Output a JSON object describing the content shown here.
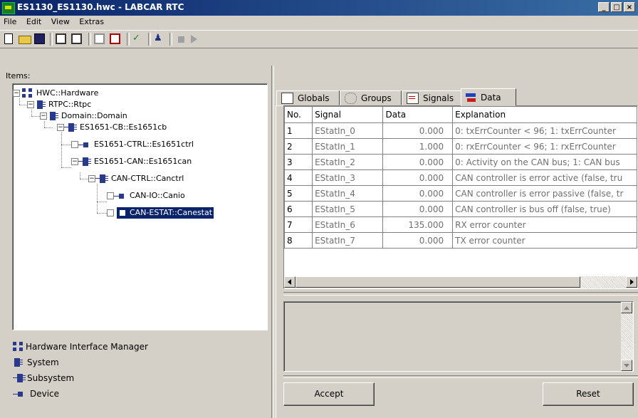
{
  "window": {
    "title": "ES1130_ES1130.hwc - LABCAR RTC",
    "min": "_",
    "max": "□",
    "close": "×"
  },
  "menu": [
    "File",
    "Edit",
    "View",
    "Extras"
  ],
  "items_label": "Items:",
  "tree": [
    {
      "label": "HWC::Hardware"
    },
    {
      "label": "RTPC::Rtpc"
    },
    {
      "label": "Domain::Domain"
    },
    {
      "label": "ES1651-CB::Es1651cb"
    },
    {
      "label": "ES1651-CTRL::Es1651ctrl"
    },
    {
      "label": "ES1651-CAN::Es1651can"
    },
    {
      "label": "CAN-CTRL::Canctrl"
    },
    {
      "label": "CAN-IO::Canio"
    },
    {
      "label": "CAN-ESTAT::Canestat"
    }
  ],
  "legend": [
    {
      "label": "Hardware Interface Manager"
    },
    {
      "label": "System"
    },
    {
      "label": "Subsystem"
    },
    {
      "label": "Device"
    }
  ],
  "tabs": [
    {
      "label": "Globals"
    },
    {
      "label": "Groups"
    },
    {
      "label": "Signals"
    },
    {
      "label": "Data"
    }
  ],
  "table": {
    "headers": [
      "No.",
      "Signal",
      "Data",
      "Explanation"
    ],
    "rows": [
      [
        "1",
        "EStatIn_0",
        "0.000",
        "0: txErrCounter < 96; 1: txErrCounter"
      ],
      [
        "2",
        "EStatIn_1",
        "1.000",
        "0: rxErrCounter < 96; 1: rxErrCounter"
      ],
      [
        "3",
        "EStatIn_2",
        "0.000",
        "0: Activity on the CAN bus; 1: CAN bus"
      ],
      [
        "4",
        "EStatIn_3",
        "0.000",
        "CAN controller is error active (false, tru"
      ],
      [
        "5",
        "EStatIn_4",
        "0.000",
        "CAN controller is error passive (false, tr"
      ],
      [
        "6",
        "EStatIn_5",
        "0.000",
        "CAN controller is bus off (false, true)"
      ],
      [
        "7",
        "EStatIn_6",
        "135.000",
        "RX error counter"
      ],
      [
        "8",
        "EStatIn_7",
        "0.000",
        "TX error counter"
      ]
    ]
  },
  "buttons": {
    "accept": "Accept",
    "reset": "Reset"
  }
}
